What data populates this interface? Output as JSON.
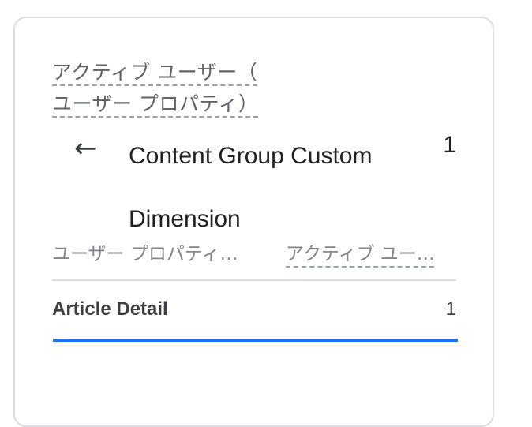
{
  "metric": {
    "title_line1": "アクティブ ユーザー（",
    "title_line2": "ユーザー プロパティ）"
  },
  "dimension": {
    "back_icon": "arrow-left-icon",
    "title": "Content Group Custom Dimension",
    "value": "1"
  },
  "table": {
    "headers": [
      "ユーザー プロパティ…",
      "アクティブ ユー…"
    ],
    "rows": [
      {
        "label": "Article Detail",
        "value": "1",
        "share": 1.0
      }
    ]
  },
  "colors": {
    "accent": "#1a73e8",
    "text": "#202124",
    "muted": "#80868b",
    "divider": "#dadce0"
  }
}
